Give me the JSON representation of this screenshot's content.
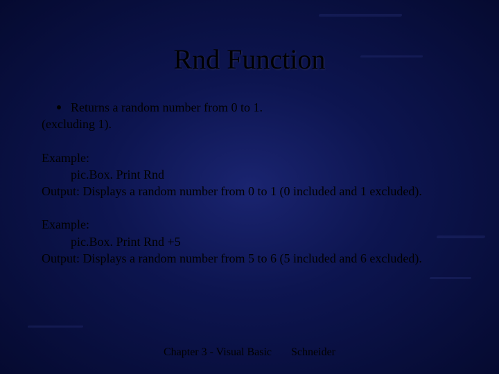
{
  "title": "Rnd Function",
  "bullet": "Returns a random number from 0 to 1.",
  "bullet_sub": "(excluding 1).",
  "ex1": {
    "label": "Example:",
    "code": "pic.Box. Print Rnd",
    "output": "Output: Displays a random number from 0 to 1 (0 included and 1 excluded)."
  },
  "ex2": {
    "label": "Example:",
    "code": "pic.Box. Print Rnd +5",
    "output": "Output: Displays a random number from 5 to 6 (5 included and 6 excluded)."
  },
  "footer": {
    "left": "Chapter 3 - Visual Basic",
    "right": "Schneider"
  }
}
